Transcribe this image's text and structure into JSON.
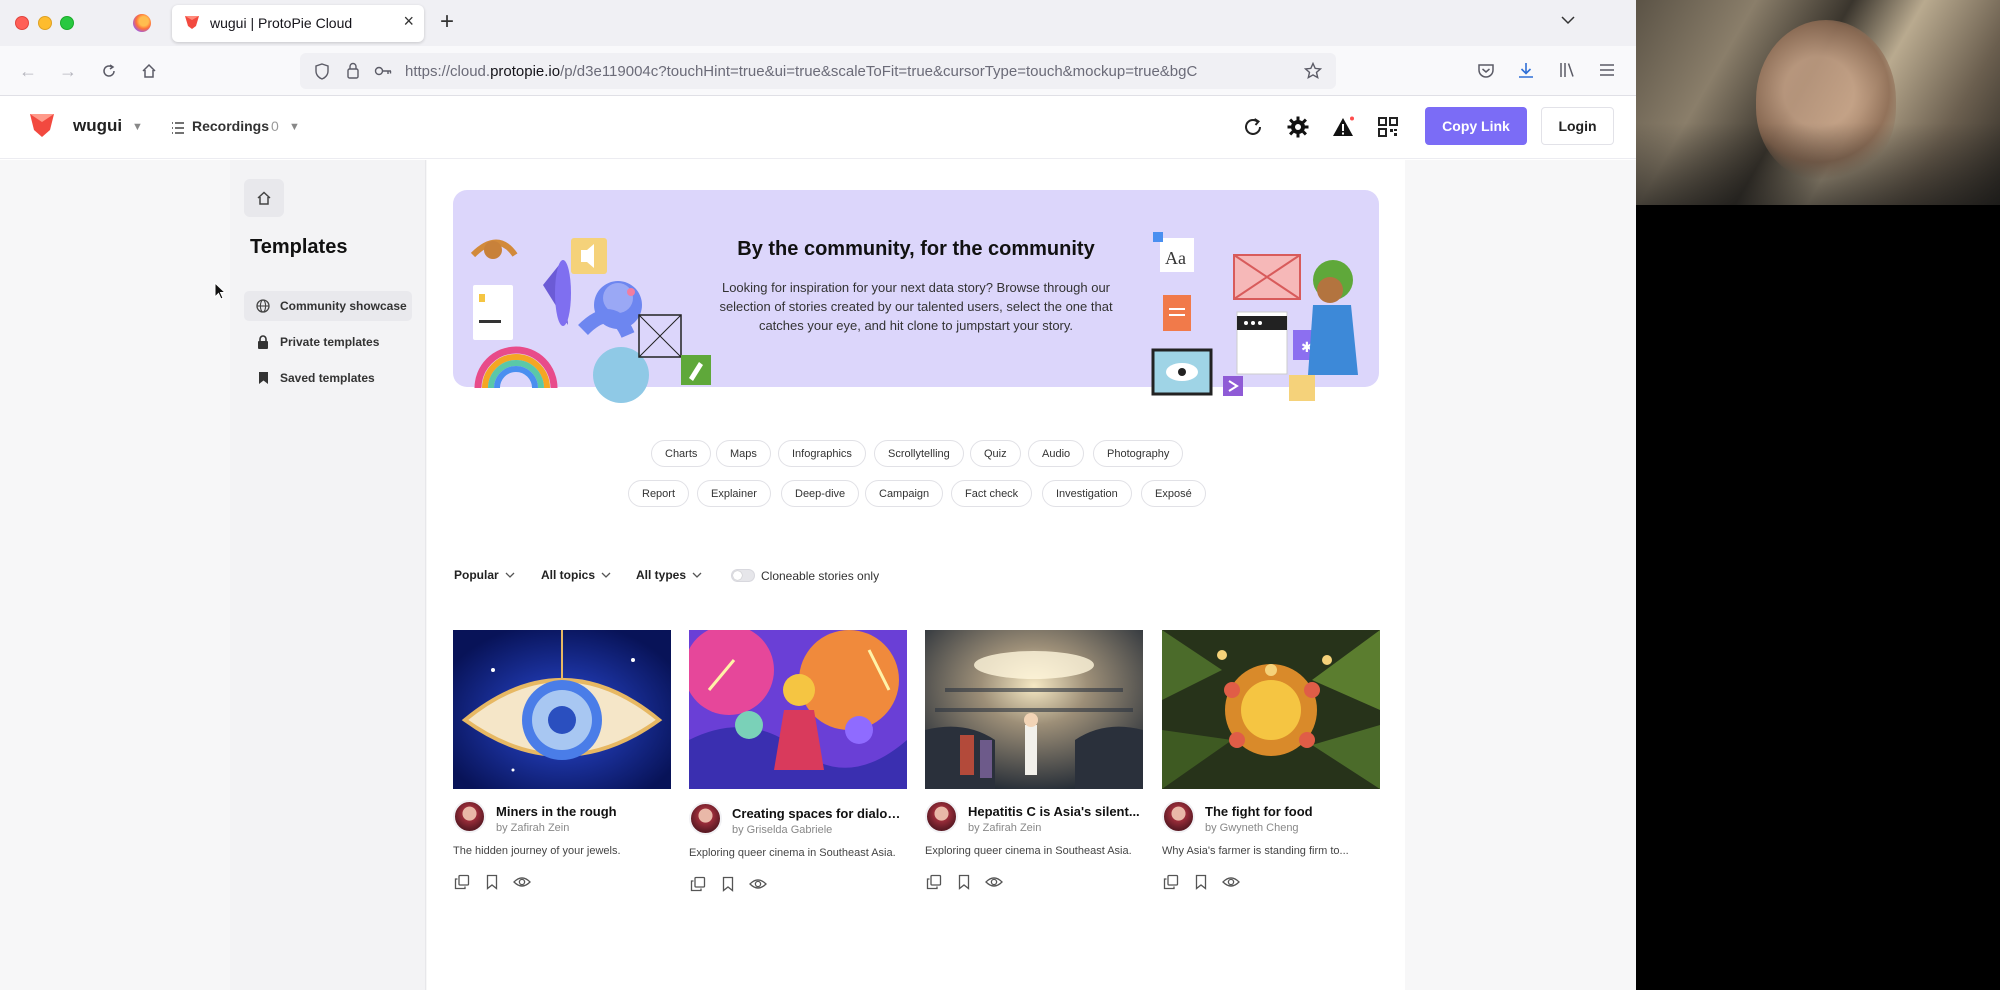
{
  "browser": {
    "tab_title": "wugui | ProtoPie Cloud",
    "url_prefix": "https://cloud.",
    "url_domain": "protopie.io",
    "url_suffix": "/p/d3e119004c?touchHint=true&ui=true&scaleToFit=true&cursorType=touch&mockup=true&bgC"
  },
  "header": {
    "project_name": "wugui",
    "recordings_label": "Recordings",
    "recordings_count": "0",
    "copy_link_label": "Copy Link",
    "login_label": "Login",
    "accent_color": "#7b6cf6"
  },
  "sidebar": {
    "title": "Templates",
    "items": [
      {
        "label": "Community showcase",
        "icon": "globe-icon",
        "active": true
      },
      {
        "label": "Private templates",
        "icon": "lock-icon",
        "active": false
      },
      {
        "label": "Saved templates",
        "icon": "bookmark-icon",
        "active": false
      }
    ]
  },
  "banner": {
    "title": "By the community, for the community",
    "description": "Looking for inspiration for your next data story? Browse through our selection of stories created by our talented users, select the one that catches your eye, and hit clone to jumpstart your story.",
    "background": "#dcd6fb"
  },
  "chips": {
    "row1": [
      "Charts",
      "Maps",
      "Infographics",
      "Scrollytelling",
      "Quiz",
      "Audio",
      "Photography"
    ],
    "row2": [
      "Report",
      "Explainer",
      "Deep-dive",
      "Campaign",
      "Fact check",
      "Investigation",
      "Exposé"
    ]
  },
  "filters": {
    "sort": "Popular",
    "topics": "All topics",
    "types": "All types",
    "cloneable_label": "Cloneable stories only",
    "cloneable_on": false
  },
  "cards": [
    {
      "title": "Miners in the rough",
      "author": "by Zafirah Zein",
      "description": "The hidden journey of your jewels."
    },
    {
      "title": "Creating spaces for dialogue",
      "author": "by Griselda Gabriele",
      "description": "Exploring queer cinema in Southeast Asia."
    },
    {
      "title": "Hepatitis C is Asia's silent...",
      "author": "by Zafirah Zein",
      "description": "Exploring queer cinema in Southeast Asia."
    },
    {
      "title": "The fight for food",
      "author": "by Gwyneth Cheng",
      "description": "Why Asia's farmer is standing firm to..."
    }
  ]
}
